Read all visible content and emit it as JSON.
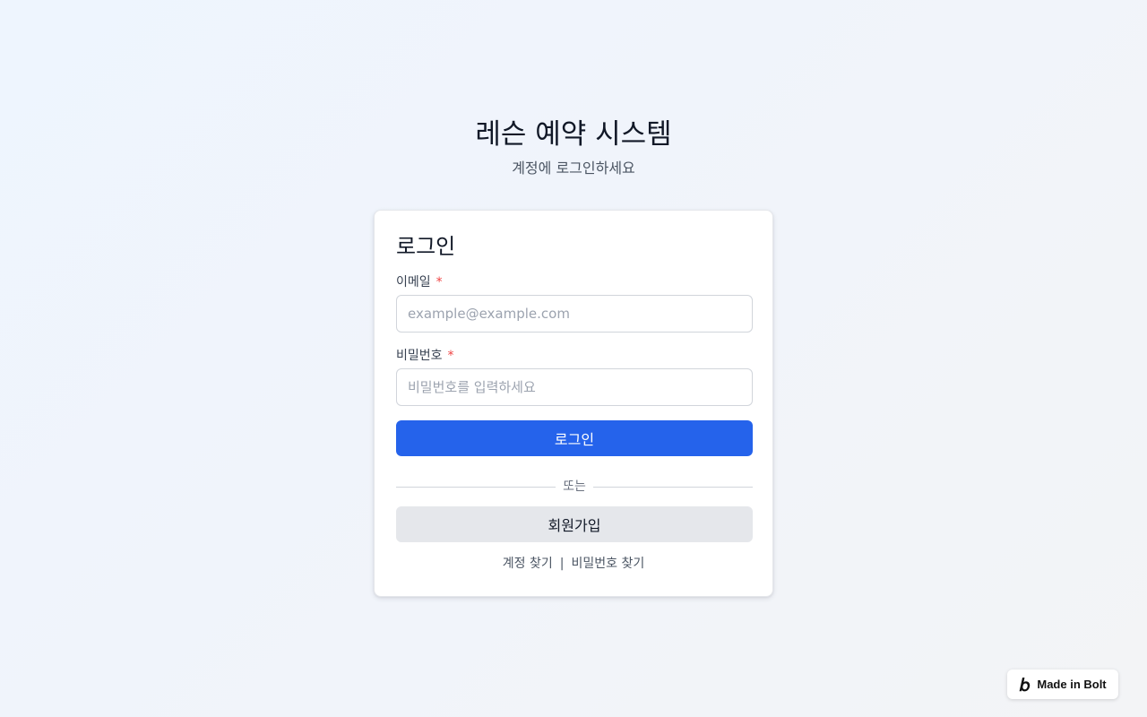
{
  "header": {
    "title": "레슨 예약 시스템",
    "subtitle": "계정에 로그인하세요"
  },
  "login_card": {
    "title": "로그인",
    "email": {
      "label": "이메일",
      "required_mark": "*",
      "placeholder": "example@example.com",
      "value": ""
    },
    "password": {
      "label": "비밀번호",
      "required_mark": "*",
      "placeholder": "비밀번호를 입력하세요",
      "value": ""
    },
    "login_button_label": "로그인",
    "divider_text": "또는",
    "signup_button_label": "회원가입",
    "links": {
      "find_account": "계정 찾기",
      "separator": "|",
      "find_password": "비밀번호 찾기"
    }
  },
  "badge": {
    "label": "Made in Bolt",
    "icon": "bolt-logo-icon"
  },
  "colors": {
    "primary": "#2563eb",
    "secondary_button": "#e5e7eb",
    "required": "#ef4444",
    "text": "#111827",
    "muted_text": "#4b5563"
  }
}
